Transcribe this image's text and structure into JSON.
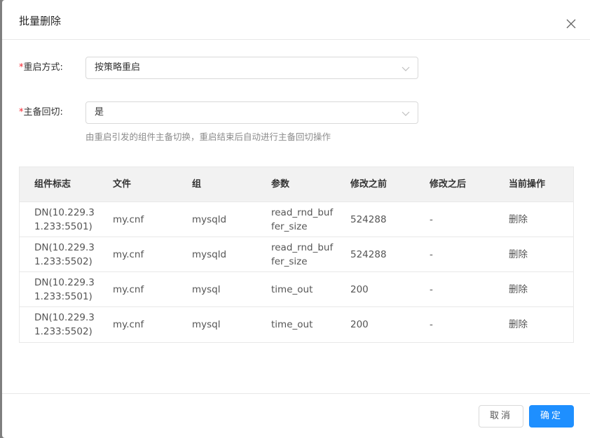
{
  "dialog": {
    "title": "批量删除"
  },
  "form": {
    "restart_mode": {
      "label": "重启方式:",
      "value": "按策略重启"
    },
    "switchback": {
      "label": "主备回切:",
      "value": "是",
      "hint": "由重启引发的组件主备切换，重启结束后自动进行主备回切操作"
    }
  },
  "table": {
    "headers": [
      "组件标志",
      "文件",
      "组",
      "参数",
      "修改之前",
      "修改之后",
      "当前操作"
    ],
    "rows": [
      [
        "DN(10.229.31.233:5501)",
        "my.cnf",
        "mysqld",
        "read_rnd_buffer_size",
        "524288",
        "-",
        "删除"
      ],
      [
        "DN(10.229.31.233:5502)",
        "my.cnf",
        "mysqld",
        "read_rnd_buffer_size",
        "524288",
        "-",
        "删除"
      ],
      [
        "DN(10.229.31.233:5501)",
        "my.cnf",
        "mysql",
        "time_out",
        "200",
        "-",
        "删除"
      ],
      [
        "DN(10.229.31.233:5502)",
        "my.cnf",
        "mysql",
        "time_out",
        "200",
        "-",
        "删除"
      ]
    ]
  },
  "footer": {
    "cancel_label": "取消",
    "ok_label": "确定"
  },
  "colors": {
    "primary": "#1e8fff",
    "required": "#f5222d"
  }
}
